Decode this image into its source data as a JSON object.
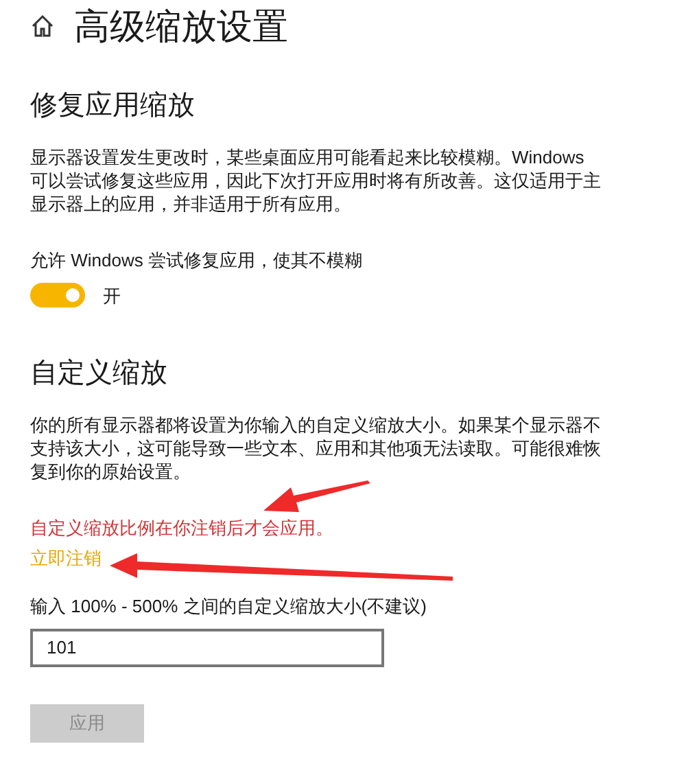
{
  "page": {
    "title": "高级缩放设置"
  },
  "fix_section": {
    "heading": "修复应用缩放",
    "description": "显示器设置发生更改时，某些桌面应用可能看起来比较模糊。Windows 可以尝试修复这些应用，因此下次打开应用时将有所改善。这仅适用于主显示器上的应用，并非适用于所有应用。",
    "toggle_label": "允许 Windows 尝试修复应用，使其不模糊",
    "toggle": {
      "on": true,
      "state_text": "开"
    }
  },
  "custom_section": {
    "heading": "自定义缩放",
    "description": "你的所有显示器都将设置为你输入的自定义缩放大小。如果某个显示器不支持该大小，这可能导致一些文本、应用和其他项无法读取。可能很难恢复到你的原始设置。",
    "warning": "自定义缩放比例在你注销后才会应用。",
    "signout_link": "立即注销",
    "input_label": "输入 100% - 500% 之间的自定义缩放大小(不建议)",
    "input": {
      "value": "101"
    },
    "apply_button": {
      "label": "应用",
      "disabled": true
    }
  }
}
